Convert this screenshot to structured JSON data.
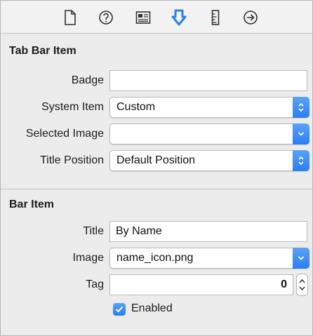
{
  "toolbar": {
    "icons": [
      "file-icon",
      "help-icon",
      "identity-icon",
      "attributes-icon",
      "size-icon",
      "connections-icon"
    ],
    "selected": "attributes-icon",
    "accent": "#2f7ff0"
  },
  "tab_bar_item": {
    "title": "Tab Bar Item",
    "badge": {
      "label": "Badge",
      "value": ""
    },
    "system_item": {
      "label": "System Item",
      "value": "Custom"
    },
    "selected_image": {
      "label": "Selected Image",
      "value": ""
    },
    "title_position": {
      "label": "Title Position",
      "value": "Default Position"
    }
  },
  "bar_item": {
    "title": "Bar Item",
    "title_field": {
      "label": "Title",
      "value": "By Name"
    },
    "image": {
      "label": "Image",
      "value": "name_icon.png"
    },
    "tag": {
      "label": "Tag",
      "value": "0"
    },
    "enabled": {
      "label": "Enabled",
      "checked": true
    }
  }
}
